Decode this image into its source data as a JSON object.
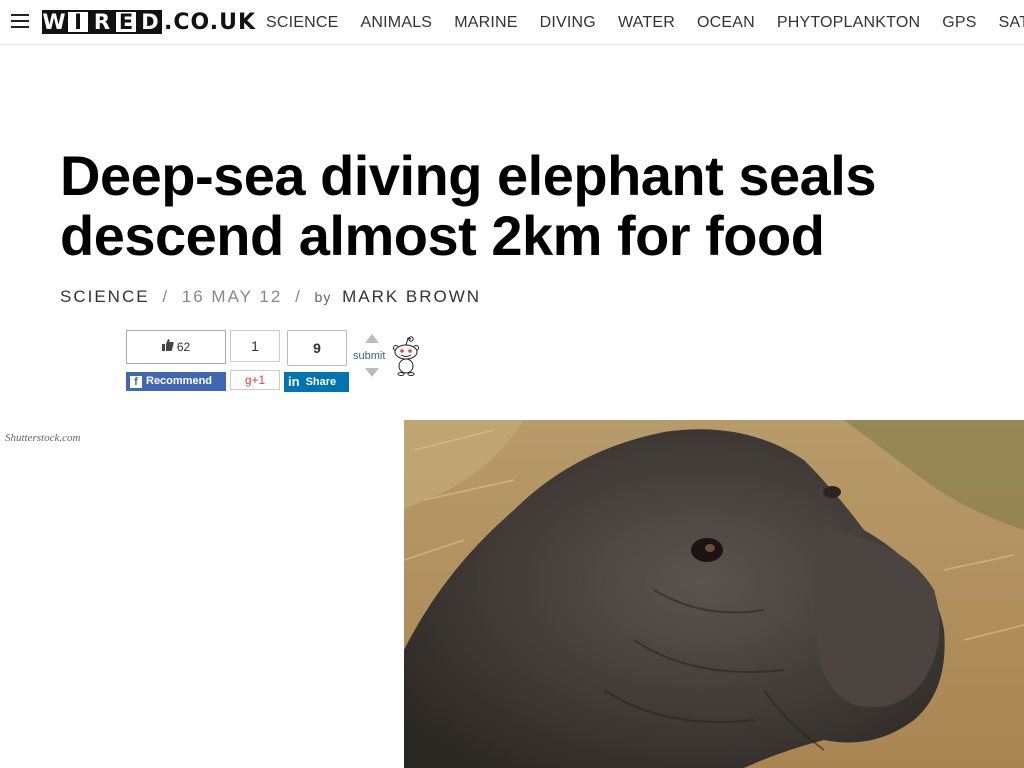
{
  "header": {
    "logo": {
      "letters": [
        "W",
        "I",
        "R",
        "E",
        "D"
      ],
      "suffix": ".CO.UK"
    },
    "nav": [
      "SCIENCE",
      "ANIMALS",
      "MARINE",
      "DIVING",
      "WATER",
      "OCEAN",
      "PHYTOPLANKTON",
      "GPS",
      "SATE"
    ]
  },
  "article": {
    "title": "Deep-sea diving elephant seals descend almost 2km for food",
    "category": "SCIENCE",
    "separator": "/",
    "date": "16 MAY 12",
    "by": "by",
    "author": "MARK BROWN"
  },
  "social": {
    "facebook": {
      "count": "62",
      "label": "Recommend"
    },
    "google": {
      "count": "1",
      "label": "+1"
    },
    "linkedin": {
      "count": "9",
      "label": "Share"
    },
    "reddit": {
      "label": "submit"
    }
  },
  "image": {
    "credit": "Shutterstock.com"
  },
  "colors": {
    "facebook": "#4267b2",
    "linkedin": "#0073b1",
    "google": "#d14836"
  }
}
